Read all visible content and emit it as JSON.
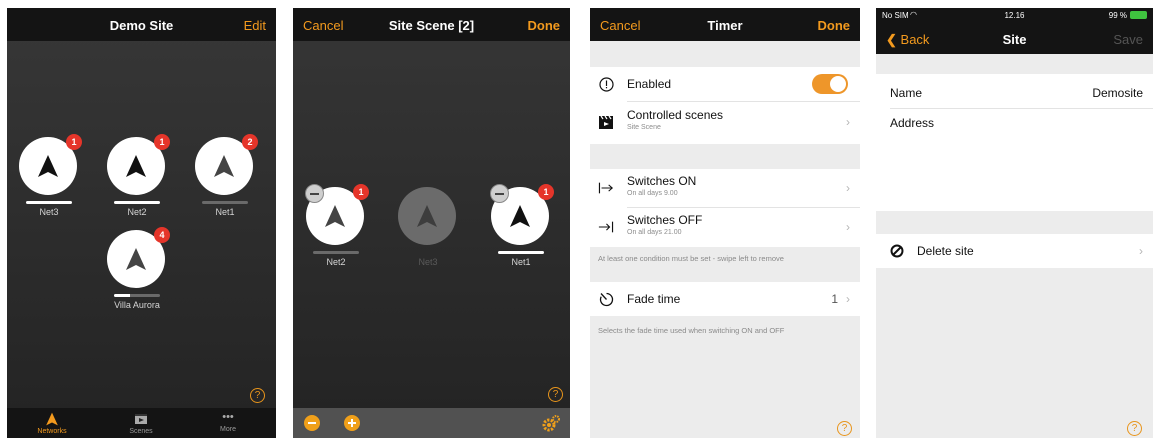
{
  "colors": {
    "accent": "#f39a1e",
    "badge": "#e5352a"
  },
  "screen1": {
    "title": "Demo Site",
    "edit": "Edit",
    "nodes": [
      {
        "label": "Net3",
        "badge": "1",
        "level": 1.0
      },
      {
        "label": "Net2",
        "badge": "1",
        "level": 1.0
      },
      {
        "label": "Net1",
        "badge": "2",
        "level": 0.0
      },
      {
        "label": "Villa Aurora",
        "badge": "4",
        "level": 0.35
      }
    ],
    "help": "?",
    "tabs": [
      {
        "label": "Networks",
        "icon": "network-icon"
      },
      {
        "label": "Scenes",
        "icon": "scene-icon"
      },
      {
        "label": "More",
        "icon": "more-icon"
      }
    ]
  },
  "screen2": {
    "title": "Site Scene [2]",
    "cancel": "Cancel",
    "done": "Done",
    "nodes": [
      {
        "label": "Net2",
        "badge": "1",
        "level": 0.0
      },
      {
        "label": "Net3",
        "badge": "",
        "level": 0.0
      },
      {
        "label": "Net1",
        "badge": "1",
        "level": 1.0
      }
    ],
    "help": "?"
  },
  "screen3": {
    "title": "Timer",
    "cancel": "Cancel",
    "done": "Done",
    "enabled_label": "Enabled",
    "enabled": true,
    "controlled_scenes": "Controlled scenes",
    "controlled_scenes_sub": "Site Scene",
    "switches_on": "Switches ON",
    "switches_on_sub": "On all days  9.00",
    "switches_off": "Switches OFF",
    "switches_off_sub": "On all days  21.00",
    "condition_note": "At least one condition must be set - swipe left to remove",
    "fade_time": "Fade time",
    "fade_value": "1",
    "fade_note": "Selects the fade time used when switching ON and OFF",
    "help": "?"
  },
  "screen4": {
    "status": {
      "carrier": "No SIM",
      "time": "12.16",
      "battery": "99 %"
    },
    "back": "Back",
    "title": "Site",
    "save": "Save",
    "name_label": "Name",
    "name_value": "Demosite",
    "address_label": "Address",
    "delete": "Delete site",
    "help": "?"
  }
}
